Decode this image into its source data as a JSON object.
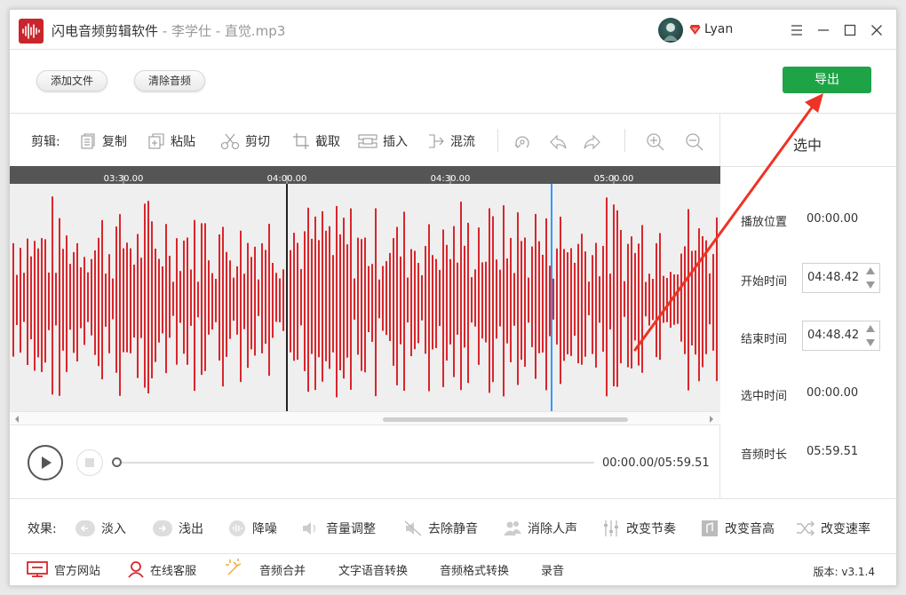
{
  "titlebar": {
    "app_name": "闪电音频剪辑软件",
    "separator": " - ",
    "file_title": "李学仕 - 直觉.mp3",
    "username": "Lyan"
  },
  "toolbar": {
    "add_file": "添加文件",
    "clear_audio": "清除音频",
    "export": "导出"
  },
  "edit_tools": {
    "label": "剪辑:",
    "copy": "复制",
    "paste": "粘贴",
    "cut": "剪切",
    "crop": "截取",
    "insert": "插入",
    "mix": "混流"
  },
  "timeline": {
    "ticks": [
      "03:30.00",
      "04:00.00",
      "04:30.00",
      "05:00.00"
    ]
  },
  "player": {
    "time_readout": "00:00.00/05:59.51"
  },
  "selection": {
    "title": "选中",
    "play_position_label": "播放位置",
    "play_position": "00:00.00",
    "start_label": "开始时间",
    "start_value": "04:48.42",
    "end_label": "结束时间",
    "end_value": "04:48.42",
    "selected_label": "选中时间",
    "selected_value": "00:00.00",
    "duration_label": "音频时长",
    "duration_value": "05:59.51"
  },
  "effects": {
    "label": "效果:",
    "fade_in": "淡入",
    "fade_out": "浅出",
    "denoise": "降噪",
    "volume": "音量调整",
    "remove_silence": "去除静音",
    "remove_vocals": "消除人声",
    "change_tempo": "改变节奏",
    "change_pitch": "改变音高",
    "change_speed": "改变速率"
  },
  "bottom": {
    "website": "官方网站",
    "support": "在线客服",
    "merge": "音频合并",
    "tts": "文字语音转换",
    "convert": "音频格式转换",
    "record": "录音",
    "version": "版本: v3.1.4"
  },
  "colors": {
    "waveform": "#d9262c",
    "export_button": "#1fa347",
    "cursor_blue": "#3399ff",
    "annotation_arrow": "#ee3324"
  }
}
